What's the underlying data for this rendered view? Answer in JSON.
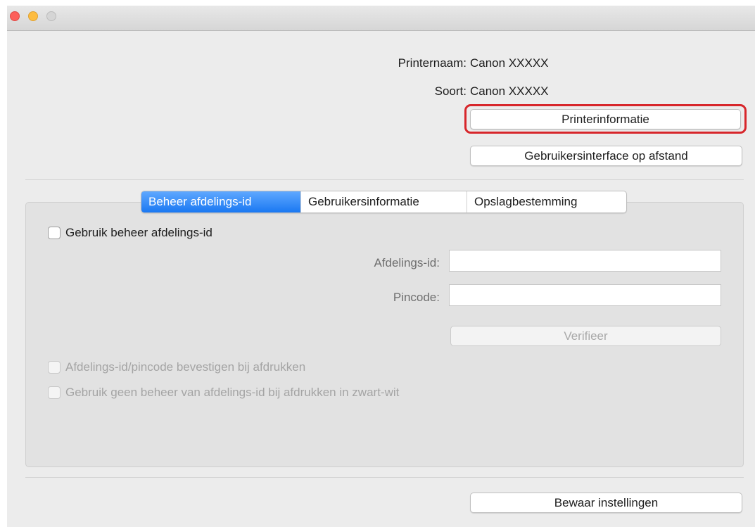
{
  "window": {
    "traffic_lights": {
      "close_color": "#fc605b",
      "minimize_color": "#fdbc40",
      "zoom_color": "#d5d5d5"
    }
  },
  "printer": {
    "name_label": "Printernaam:",
    "name_value": "Canon XXXXX",
    "type_label": "Soort:",
    "type_value": "Canon XXXXX"
  },
  "buttons": {
    "printer_info": "Printerinformatie",
    "remote_ui": "Gebruikersinterface op afstand",
    "verify": "Verifieer",
    "save_settings": "Bewaar instellingen"
  },
  "tabs": [
    {
      "label": "Beheer afdelings-id",
      "active": true
    },
    {
      "label": "Gebruikersinformatie",
      "active": false
    },
    {
      "label": "Opslagbestemming",
      "active": false
    }
  ],
  "department": {
    "use_management_label": "Gebruik beheer afdelings-id",
    "use_management_checked": false,
    "dept_id_label": "Afdelings-id:",
    "dept_id_value": "",
    "pin_label": "Pincode:",
    "pin_value": "",
    "confirm_on_print_label": "Afdelings-id/pincode bevestigen bij afdrukken",
    "confirm_on_print_checked": false,
    "no_management_bw_label": "Gebruik geen beheer van afdelings-id bij afdrukken in zwart-wit",
    "no_management_bw_checked": false
  },
  "colors": {
    "highlight": "#d7262b",
    "active_tab": "#1a78f2"
  }
}
